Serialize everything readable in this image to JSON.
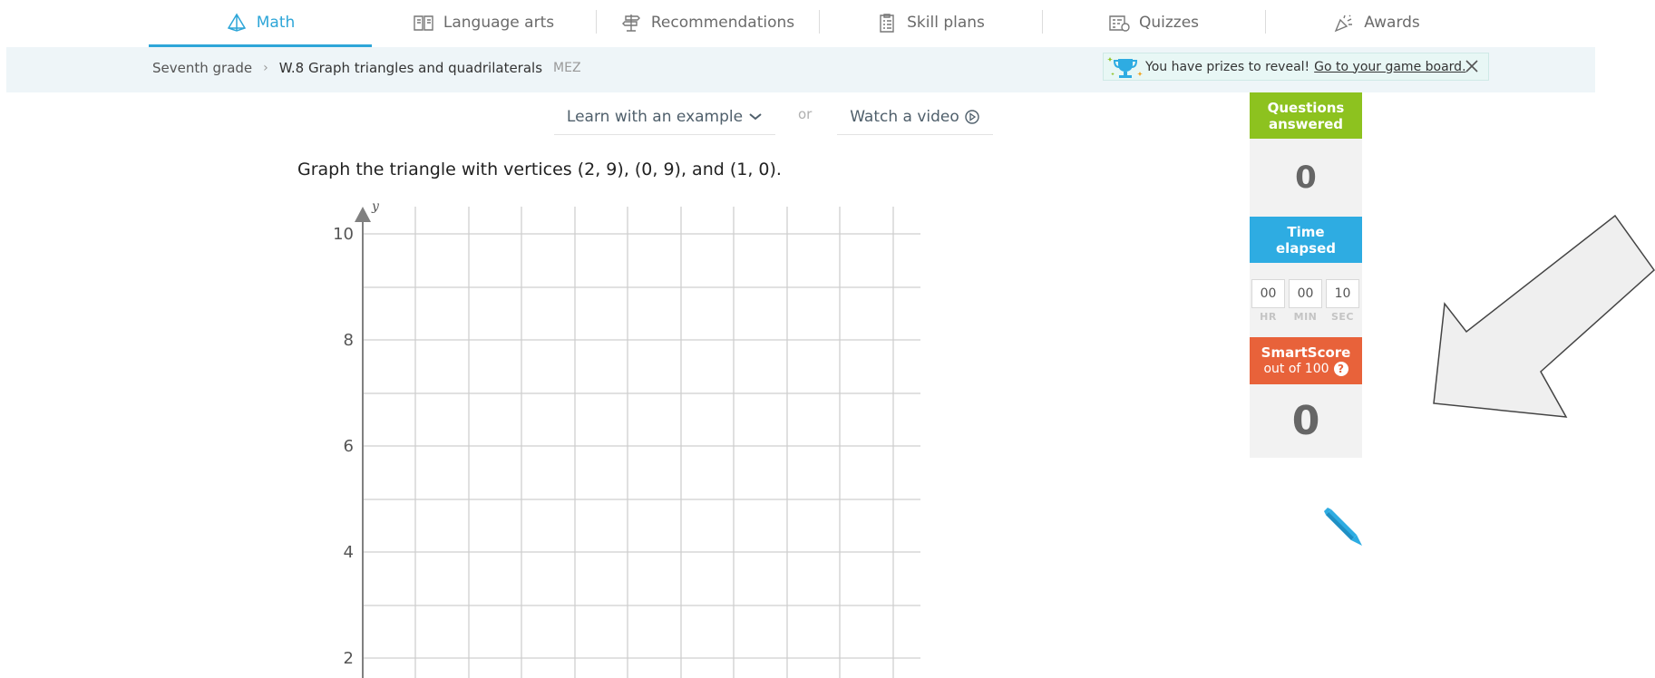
{
  "nav": {
    "tabs": [
      {
        "label": "Math",
        "active": true,
        "icon": "pyramid-icon"
      },
      {
        "label": "Language arts",
        "active": false,
        "icon": "book-icon"
      },
      {
        "label": "Recommendations",
        "active": false,
        "icon": "signpost-icon"
      },
      {
        "label": "Skill plans",
        "active": false,
        "icon": "clipboard-list-icon"
      },
      {
        "label": "Quizzes",
        "active": false,
        "icon": "quiz-icon"
      },
      {
        "label": "Awards",
        "active": false,
        "icon": "party-popper-icon"
      }
    ]
  },
  "breadcrumb": {
    "grade": "Seventh grade",
    "skill": "W.8 Graph triangles and quadrilaterals",
    "code": "MEZ"
  },
  "prize": {
    "text": "You have prizes to reveal!",
    "link": "Go to your game board."
  },
  "learn": {
    "example_label": "Learn with an example",
    "or_label": "or",
    "video_label": "Watch a video"
  },
  "question": {
    "text": "Graph the triangle with vertices (2, 9), (0, 9), and (1, 0)."
  },
  "graph": {
    "axis_label_y": "y",
    "y_ticks": [
      "10",
      "8",
      "6",
      "4",
      "2"
    ]
  },
  "stats": {
    "questions_label_1": "Questions",
    "questions_label_2": "answered",
    "questions_value": "0",
    "time_label_1": "Time",
    "time_label_2": "elapsed",
    "time": {
      "hr": "00",
      "min": "00",
      "sec": "10"
    },
    "time_units": {
      "hr": "HR",
      "min": "MIN",
      "sec": "SEC"
    },
    "smartscore_label": "SmartScore",
    "smartscore_sub": "out of 100",
    "smartscore_help": "?",
    "smartscore_value": "0"
  },
  "colors": {
    "accent": "#2ea6d8",
    "questions_green": "#8dc21f",
    "time_blue": "#2eace2",
    "smartscore_orange": "#e8623a"
  }
}
